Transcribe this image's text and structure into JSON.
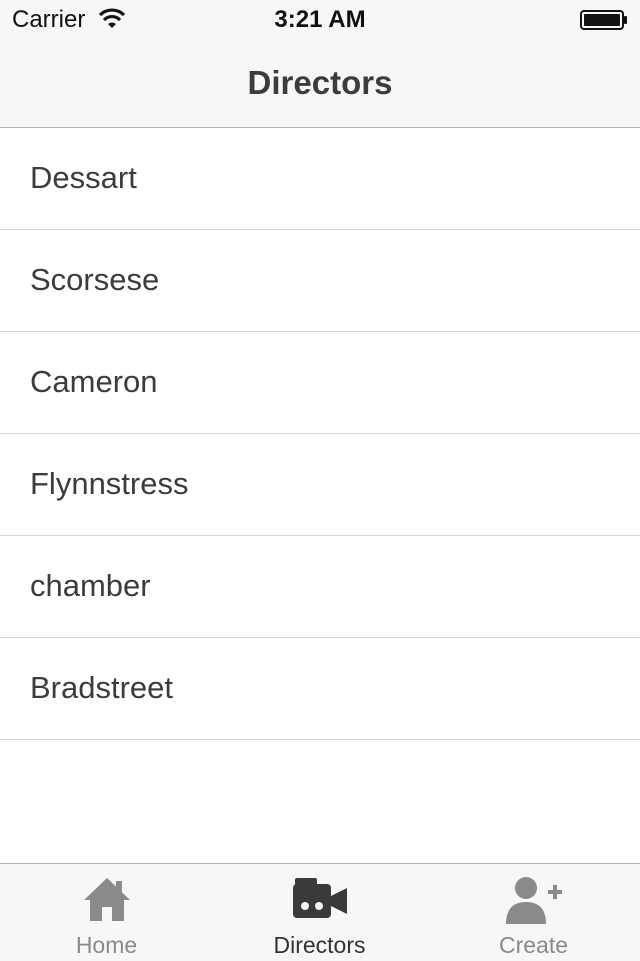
{
  "status_bar": {
    "carrier": "Carrier",
    "time": "3:21 AM"
  },
  "nav": {
    "title": "Directors"
  },
  "directors": [
    {
      "name": "Dessart"
    },
    {
      "name": "Scorsese"
    },
    {
      "name": "Cameron"
    },
    {
      "name": "Flynnstress"
    },
    {
      "name": "chamber"
    },
    {
      "name": "Bradstreet"
    }
  ],
  "tabs": [
    {
      "label": "Home",
      "icon": "home-icon",
      "active": false
    },
    {
      "label": "Directors",
      "icon": "video-camera-icon",
      "active": true
    },
    {
      "label": "Create",
      "icon": "add-user-icon",
      "active": false
    }
  ],
  "colors": {
    "active_tab": "#333333",
    "inactive_tab": "#8a8a8a",
    "bar_background": "#f7f7f7"
  }
}
